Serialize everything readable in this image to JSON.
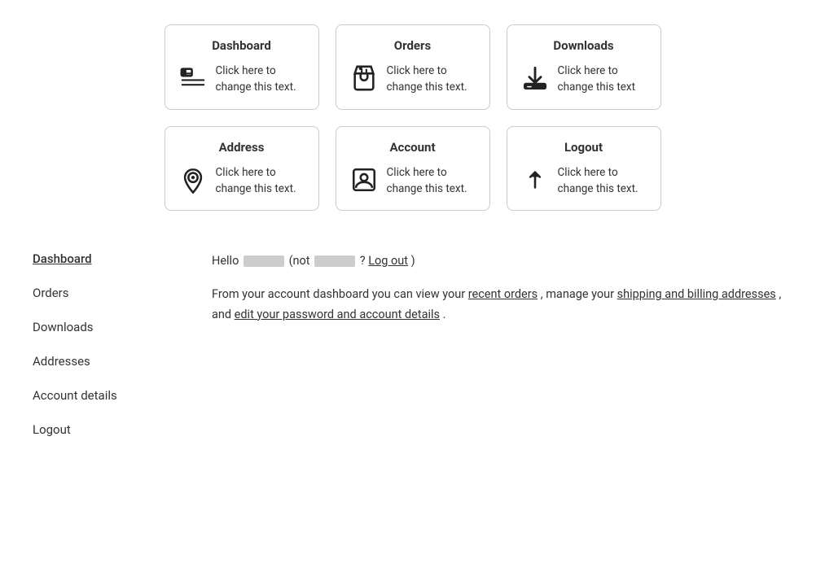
{
  "cards": [
    {
      "id": "dashboard",
      "title": "Dashboard",
      "text": "Click here to change this text.",
      "icon": "dashboard"
    },
    {
      "id": "orders",
      "title": "Orders",
      "text": "Click here to change this text.",
      "icon": "orders"
    },
    {
      "id": "downloads",
      "title": "Downloads",
      "text": "Click here to change this text",
      "icon": "downloads"
    },
    {
      "id": "address",
      "title": "Address",
      "text": "Click here to change this text.",
      "icon": "address"
    },
    {
      "id": "account",
      "title": "Account",
      "text": "Click here to change this text.",
      "icon": "account"
    },
    {
      "id": "logout",
      "title": "Logout",
      "text": "Click here to change this text.",
      "icon": "logout"
    }
  ],
  "sidebar": {
    "items": [
      {
        "label": "Dashboard",
        "active": true,
        "id": "dashboard"
      },
      {
        "label": "Orders",
        "active": false,
        "id": "orders"
      },
      {
        "label": "Downloads",
        "active": false,
        "id": "downloads"
      },
      {
        "label": "Addresses",
        "active": false,
        "id": "addresses"
      },
      {
        "label": "Account details",
        "active": false,
        "id": "account-details"
      },
      {
        "label": "Logout",
        "active": false,
        "id": "logout"
      }
    ]
  },
  "main": {
    "hello_prefix": "Hello",
    "hello_not": "(not",
    "hello_question": "?",
    "hello_paren_close": ")",
    "log_out_label": "Log out",
    "description": "From your account dashboard you can view your recent orders, manage your shipping and billing addresses, and edit your password and account details.",
    "link_recent_orders": "recent orders",
    "link_shipping": "shipping and billing addresses",
    "link_edit_account": "edit your password and account details"
  },
  "icons": {
    "dashboard": "&#x1F4CB;",
    "orders": "&#x1F6D2;",
    "downloads": "&#x2B07;",
    "address": "&#x1F4CD;",
    "account": "&#x1F464;",
    "logout": "&#x2191;"
  }
}
